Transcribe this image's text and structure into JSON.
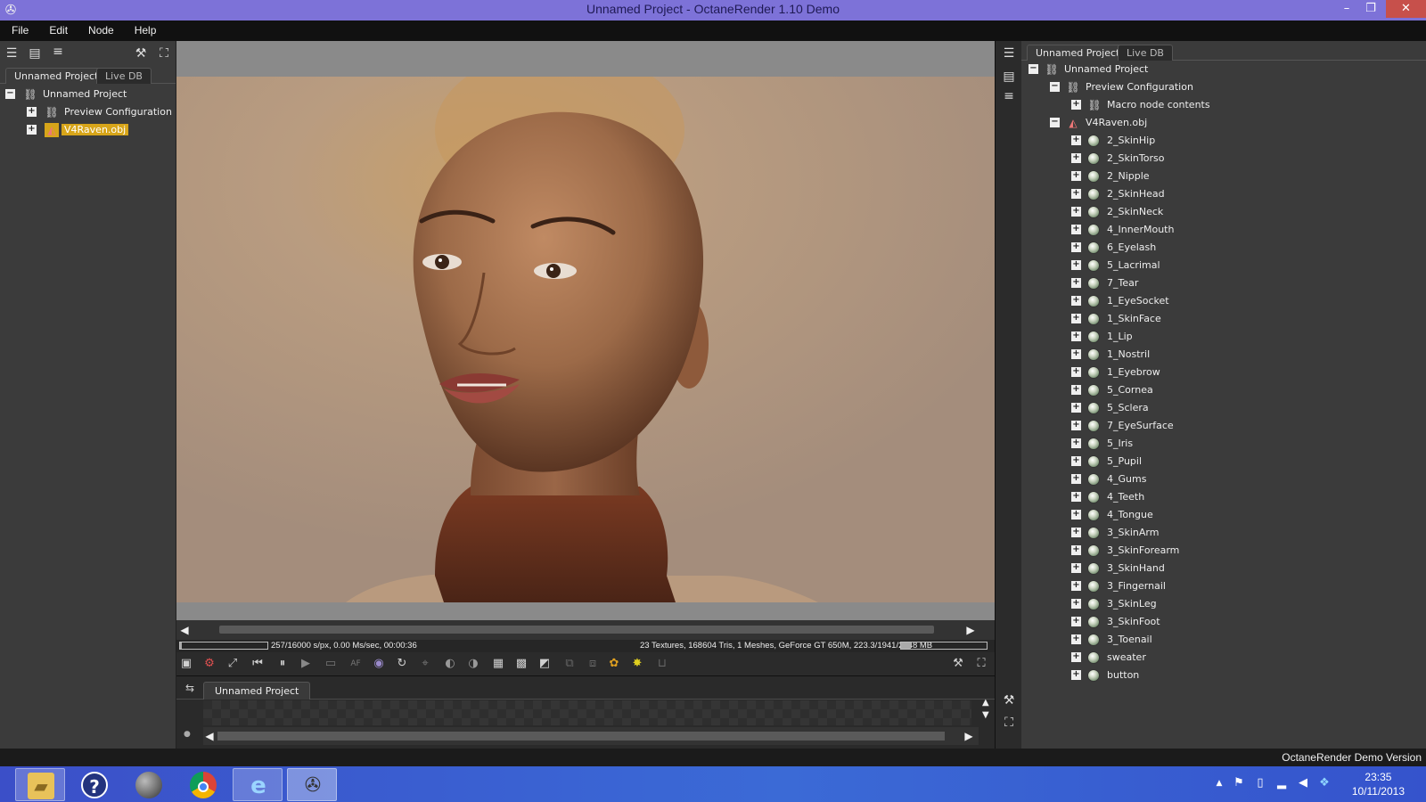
{
  "window": {
    "title": "Unnamed Project - OctaneRender 1.10 Demo",
    "minimize": "–",
    "restore": "❐",
    "close": "✕"
  },
  "menubar": [
    "File",
    "Edit",
    "Node",
    "Help"
  ],
  "left_panel": {
    "tabs": [
      "Unnamed Project",
      "Live DB"
    ],
    "tree": [
      {
        "label": "Unnamed Project",
        "expander": "−",
        "icon": "scene-icon",
        "selected": false
      },
      {
        "label": "Preview Configuration",
        "expander": "+",
        "icon": "scene-icon",
        "selected": false
      },
      {
        "label": "V4Raven.obj",
        "expander": "+",
        "icon": "mesh-icon",
        "selected": true
      }
    ]
  },
  "render": {
    "status_left": "257/16000 s/px, 0.00 Ms/sec, 00:00:36",
    "status_right": "23 Textures, 168604 Tris, 1 Meshes, GeForce GT 650M, 223.3/1941/2048 MB",
    "progress": 0.016,
    "memory_usage": 0.11
  },
  "graph_editor": {
    "tab": "Unnamed Project"
  },
  "right_panel": {
    "tabs": [
      "Unnamed Project",
      "Live DB"
    ],
    "root": "Unnamed Project",
    "preview_config": "Preview Configuration",
    "macro": "Macro node contents",
    "mesh": "V4Raven.obj",
    "materials": [
      "2_SkinHip",
      "2_SkinTorso",
      "2_Nipple",
      "2_SkinHead",
      "2_SkinNeck",
      "4_InnerMouth",
      "6_Eyelash",
      "5_Lacrimal",
      "7_Tear",
      "1_EyeSocket",
      "1_SkinFace",
      "1_Lip",
      "1_Nostril",
      "1_Eyebrow",
      "5_Cornea",
      "5_Sclera",
      "7_EyeSurface",
      "5_Iris",
      "5_Pupil",
      "4_Gums",
      "4_Teeth",
      "4_Tongue",
      "3_SkinArm",
      "3_SkinForearm",
      "3_SkinHand",
      "3_Fingernail",
      "3_SkinLeg",
      "3_SkinFoot",
      "3_Toenail",
      "sweater",
      "button"
    ]
  },
  "footer": {
    "demo_text": "OctaneRender Demo Version"
  },
  "taskbar": {
    "time": "23:35",
    "date": "10/11/2013",
    "apps": [
      "file-explorer-icon",
      "help-icon",
      "globe-icon",
      "chrome-icon",
      "internet-explorer-icon",
      "octane-icon"
    ]
  },
  "colors": {
    "titlebar": "#7d72d8",
    "selection": "#d7a51a",
    "taskbar": "#3a63d3"
  }
}
